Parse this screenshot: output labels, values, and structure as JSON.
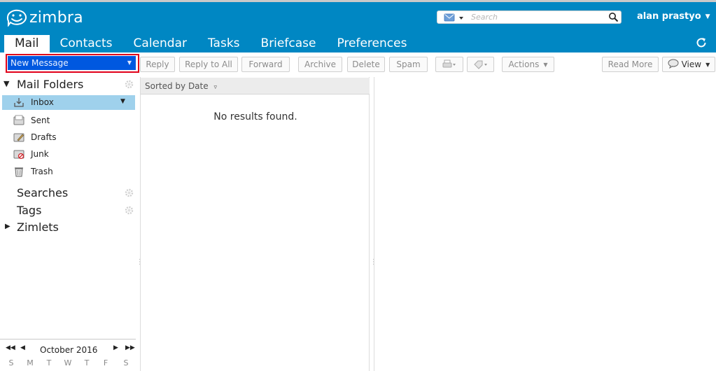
{
  "app": {
    "brand": "zimbra"
  },
  "search": {
    "placeholder": "Search"
  },
  "user": {
    "name": "alan prastyo"
  },
  "tabs": [
    {
      "label": "Mail"
    },
    {
      "label": "Contacts"
    },
    {
      "label": "Calendar"
    },
    {
      "label": "Tasks"
    },
    {
      "label": "Briefcase"
    },
    {
      "label": "Preferences"
    }
  ],
  "toolbar": {
    "new_message": "New Message",
    "reply": "Reply",
    "reply_all": "Reply to All",
    "forward": "Forward",
    "archive": "Archive",
    "delete": "Delete",
    "spam": "Spam",
    "actions": "Actions",
    "read_more": "Read More",
    "view": "View"
  },
  "folders": {
    "header": "Mail Folders",
    "items": [
      {
        "label": "Inbox",
        "icon": "inbox-icon",
        "selected": true
      },
      {
        "label": "Sent",
        "icon": "sent-folder-icon"
      },
      {
        "label": "Drafts",
        "icon": "drafts-folder-icon"
      },
      {
        "label": "Junk",
        "icon": "junk-folder-icon"
      },
      {
        "label": "Trash",
        "icon": "trash-icon"
      }
    ]
  },
  "sections": {
    "searches": "Searches",
    "tags": "Tags",
    "zimlets": "Zimlets"
  },
  "list": {
    "sort_label": "Sorted by Date",
    "empty": "No results found."
  },
  "calendar": {
    "month": "October 2016",
    "weekdays": [
      "S",
      "M",
      "T",
      "W",
      "T",
      "F",
      "S"
    ]
  },
  "colors": {
    "header_bg": "#0087c3",
    "new_message_bg": "#0058e0",
    "selected_row": "#9fd1ec",
    "highlight_outline": "#e0001a"
  }
}
